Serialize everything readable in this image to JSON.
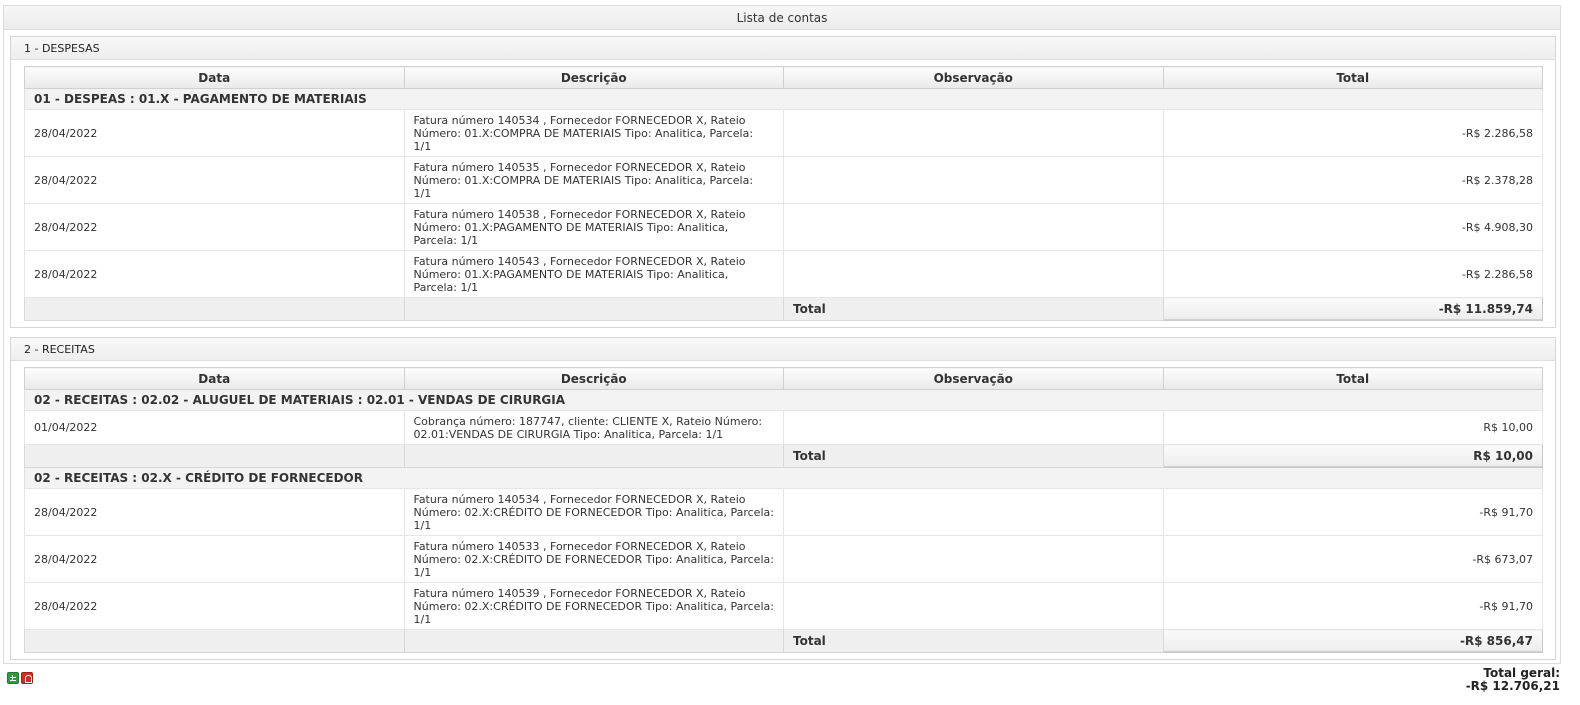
{
  "title": "Lista de contas",
  "columns": [
    "Data",
    "Descrição",
    "Observação",
    "Total"
  ],
  "total_label": "Total",
  "despesas": {
    "header": "1 - DESPESAS",
    "groups": [
      {
        "name": "01 - DESPEAS : 01.X - PAGAMENTO DE MATERIAIS",
        "rows": [
          {
            "date": "28/04/2022",
            "description": "Fatura número 140534 , Fornecedor FORNECEDOR X, Rateio Número: 01.X:COMPRA DE MATERIAIS Tipo: Analitica, Parcela: 1/1",
            "observation": "",
            "total": "-R$ 2.286,58"
          },
          {
            "date": "28/04/2022",
            "description": "Fatura número 140535 , Fornecedor FORNECEDOR X, Rateio Número: 01.X:COMPRA DE MATERIAIS Tipo: Analitica, Parcela: 1/1",
            "observation": "",
            "total": "-R$ 2.378,28"
          },
          {
            "date": "28/04/2022",
            "description": "Fatura número 140538 , Fornecedor FORNECEDOR X, Rateio Número: 01.X:PAGAMENTO DE MATERIAIS Tipo: Analitica, Parcela: 1/1",
            "observation": "",
            "total": "-R$ 4.908,30"
          },
          {
            "date": "28/04/2022",
            "description": "Fatura número 140543 , Fornecedor FORNECEDOR X, Rateio Número: 01.X:PAGAMENTO DE MATERIAIS Tipo: Analitica, Parcela: 1/1",
            "observation": "",
            "total": "-R$ 2.286,58"
          }
        ],
        "total": "-R$ 11.859,74"
      }
    ]
  },
  "receitas": {
    "header": "2 - RECEITAS",
    "groups": [
      {
        "name": "02 - RECEITAS : 02.02 - ALUGUEL DE MATERIAIS : 02.01 - VENDAS DE CIRURGIA",
        "rows": [
          {
            "date": "01/04/2022",
            "description": "Cobrança número: 187747, cliente: CLIENTE X, Rateio Número: 02.01:VENDAS DE CIRURGIA Tipo: Analitica, Parcela: 1/1",
            "observation": "",
            "total": "R$ 10,00"
          }
        ],
        "total": "R$ 10,00"
      },
      {
        "name": "02 - RECEITAS : 02.X - CRÉDITO DE FORNECEDOR",
        "rows": [
          {
            "date": "28/04/2022",
            "description": "Fatura número 140534 , Fornecedor FORNECEDOR X, Rateio Número: 02.X:CRÉDITO DE FORNECEDOR Tipo: Analitica, Parcela: 1/1",
            "observation": "",
            "total": "-R$ 91,70"
          },
          {
            "date": "28/04/2022",
            "description": "Fatura número 140533 , Fornecedor FORNECEDOR X, Rateio Número: 02.X:CRÉDITO DE FORNECEDOR Tipo: Analitica, Parcela: 1/1",
            "observation": "",
            "total": "-R$ 673,07"
          },
          {
            "date": "28/04/2022",
            "description": "Fatura número 140539 , Fornecedor FORNECEDOR X, Rateio Número: 02.X:CRÉDITO DE FORNECEDOR Tipo: Analitica, Parcela: 1/1",
            "observation": "",
            "total": "-R$ 91,70"
          }
        ],
        "total": "-R$ 856,47"
      }
    ]
  },
  "grand_total": {
    "label": "Total geral:",
    "value": "-R$ 12.706,21"
  },
  "export_icons": [
    "excel-icon",
    "pdf-icon"
  ]
}
